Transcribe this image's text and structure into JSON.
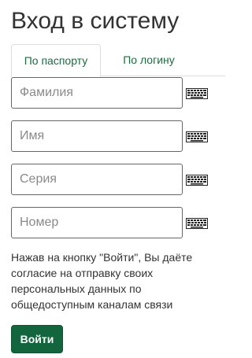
{
  "page": {
    "title": "Вход в систему"
  },
  "tabs": [
    {
      "label": "По паспорту",
      "active": true
    },
    {
      "label": "По логину",
      "active": false
    }
  ],
  "form": {
    "fields": [
      {
        "placeholder": "Фамилия",
        "value": ""
      },
      {
        "placeholder": "Имя",
        "value": ""
      },
      {
        "placeholder": "Серия",
        "value": ""
      },
      {
        "placeholder": "Номер",
        "value": ""
      }
    ],
    "keyboard_icon": "virtual-keyboard-icon"
  },
  "consent_text": "Нажав на кнопку \"Войти\", Вы даёте согласие на отправку своих персональных данных по общедоступным каналам связи",
  "submit_label": "Войти",
  "colors": {
    "accent": "#12653c",
    "tab_text": "#1a6b40",
    "border": "#666666"
  }
}
